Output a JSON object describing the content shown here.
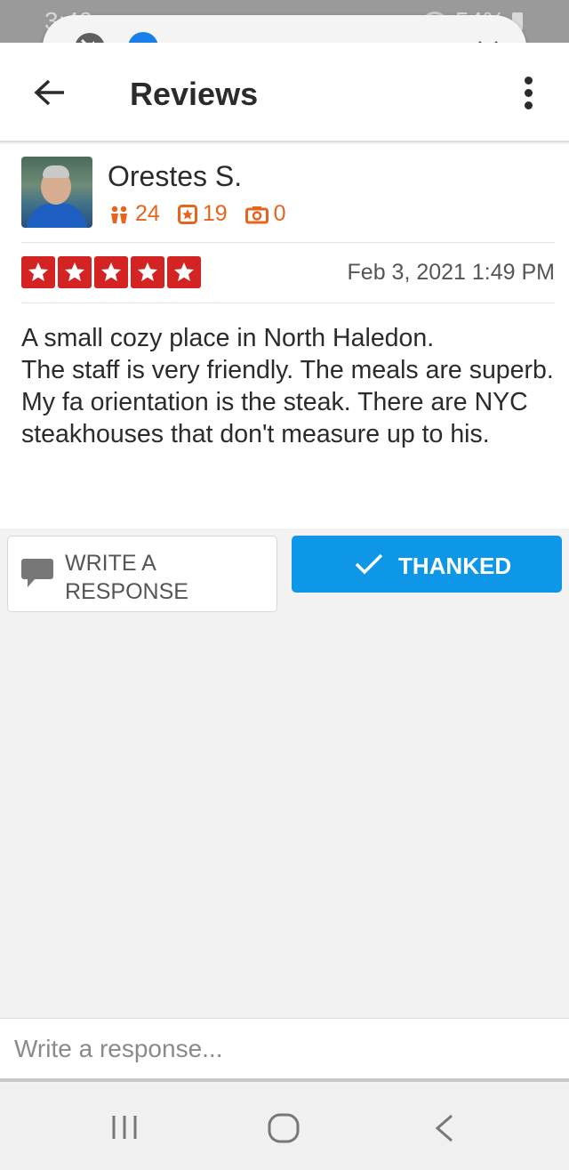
{
  "status_bar": {
    "time": "3:49",
    "battery": "54%"
  },
  "media_overlay": {
    "volume_level": 0.0
  },
  "app_bar": {
    "title": "Reviews"
  },
  "review": {
    "author": "Orestes S.",
    "friends_count": "24",
    "reviews_count": "19",
    "photos_count": "0",
    "rating": 5,
    "date": "Feb 3, 2021 1:49 PM",
    "text_lines": [
      "A small cozy place in North Haledon.",
      "The staff is very friendly. The meals are superb.",
      "My fa orientation is the steak. There are NYC steakhouses that don't measure up to his."
    ]
  },
  "actions": {
    "write_response_label": "WRITE A RESPONSE",
    "thanked_label": "THANKED"
  },
  "response_input": {
    "placeholder": "Write a response...",
    "value": ""
  },
  "colors": {
    "accent_blue": "#0e97e6",
    "star_red": "#d32323",
    "stat_orange": "#e5641e"
  },
  "icons": {
    "back": "arrow-left-icon",
    "more": "more-vertical-icon",
    "friends": "friends-icon",
    "reviews": "star-badge-icon",
    "photos": "camera-icon",
    "speech": "speech-bubble-icon",
    "check": "check-icon"
  }
}
